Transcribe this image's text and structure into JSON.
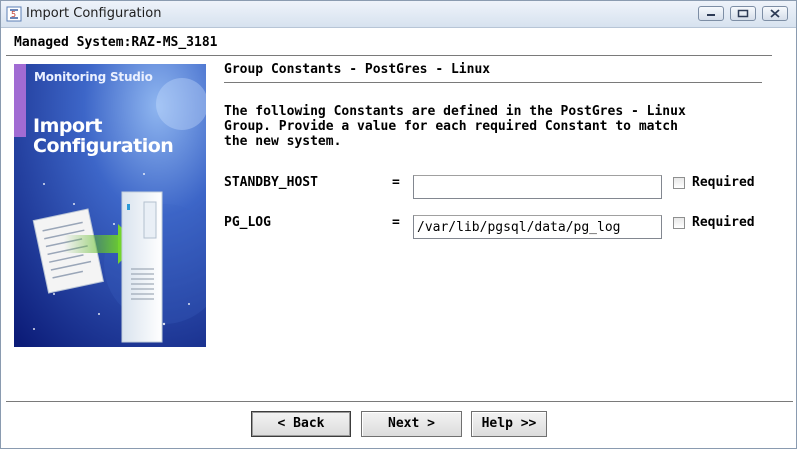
{
  "window": {
    "title": "Import Configuration"
  },
  "managed_system": "Managed System:RAZ-MS_3181",
  "hero": {
    "brand": "Monitoring Studio",
    "title_line1": "Import",
    "title_line2": "Configuration"
  },
  "section": {
    "title": "Group Constants - PostGres - Linux"
  },
  "description": {
    "line1": "The following Constants are defined in the PostGres - Linux",
    "line2": "Group. Provide a value for each required Constant to match",
    "line3": "the new system."
  },
  "constants": [
    {
      "name": "STANDBY_HOST",
      "eq": "=",
      "value": "",
      "required_label": "Required",
      "required": false
    },
    {
      "name": "PG_LOG",
      "eq": "=",
      "value": "/var/lib/pgsql/data/pg_log",
      "required_label": "Required",
      "required": false
    }
  ],
  "buttons": {
    "back": "< Back",
    "next": "Next >",
    "help": "Help >>"
  }
}
